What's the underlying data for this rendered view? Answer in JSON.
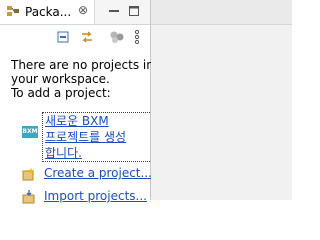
{
  "view": {
    "tab_title": "Packa...",
    "close_symbol": "⊗"
  },
  "message": {
    "lines": [
      "There are no projects in",
      "your workspace.",
      "To add a project:"
    ]
  },
  "links": {
    "bxm_create": [
      "새로운 BXM",
      "프로젝트를 생성",
      "합니다."
    ],
    "bxm_icon_text": "BXM",
    "create_project": "Create a project...",
    "import_projects": "Import projects..."
  },
  "colors": {
    "link": "#1a4dc4",
    "bxm_icon": "#3aa7c7"
  }
}
